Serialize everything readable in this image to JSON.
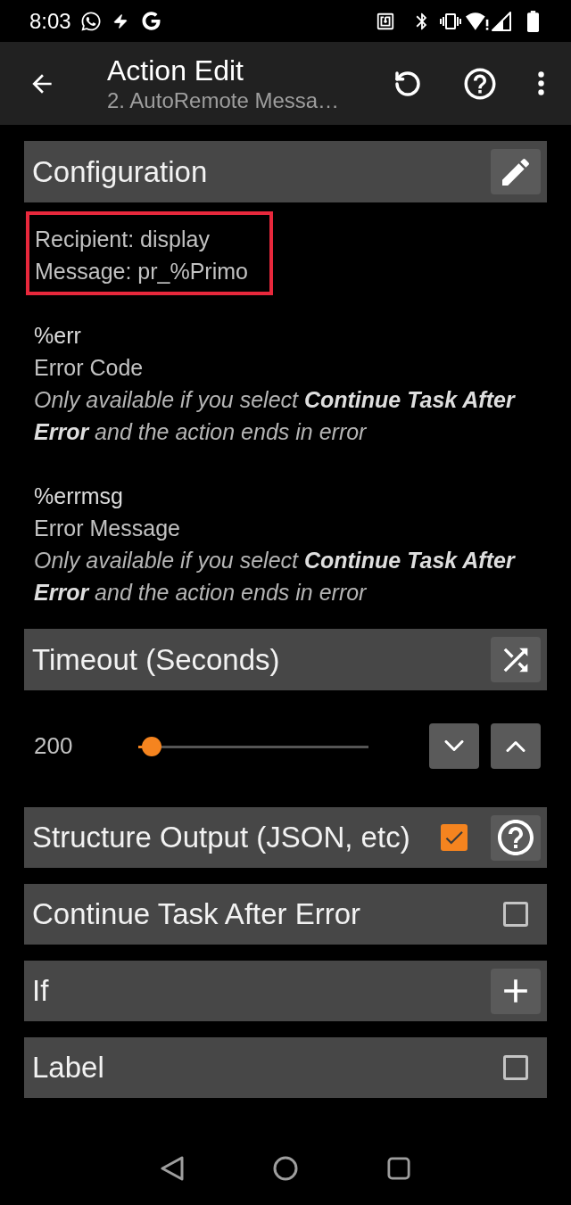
{
  "status_bar": {
    "time": "8:03"
  },
  "app_bar": {
    "title": "Action Edit",
    "subtitle": "2. AutoRemote Messa…"
  },
  "configuration": {
    "title": "Configuration",
    "highlighted": true,
    "lines": [
      "Recipient: display",
      "Message: pr_%Primo"
    ]
  },
  "variables": [
    {
      "name": "%err",
      "label": "Error Code",
      "note": "Only available if you select **Continue Task After Error** and the action ends in error"
    },
    {
      "name": "%errmsg",
      "label": "Error Message",
      "note": "Only available if you select **Continue Task After Error** and the action ends in error"
    }
  ],
  "timeout": {
    "title": "Timeout (Seconds)",
    "value": "200",
    "level": 0.06
  },
  "options": [
    {
      "kind": "checkbox",
      "label": "Structure Output (JSON, etc)",
      "checked": true,
      "help": true
    },
    {
      "kind": "checkbox",
      "label": "Continue Task After Error",
      "checked": false,
      "help": false
    },
    {
      "kind": "add",
      "label": "If"
    },
    {
      "kind": "checkbox",
      "label": "Label",
      "checked": false,
      "help": false
    }
  ]
}
